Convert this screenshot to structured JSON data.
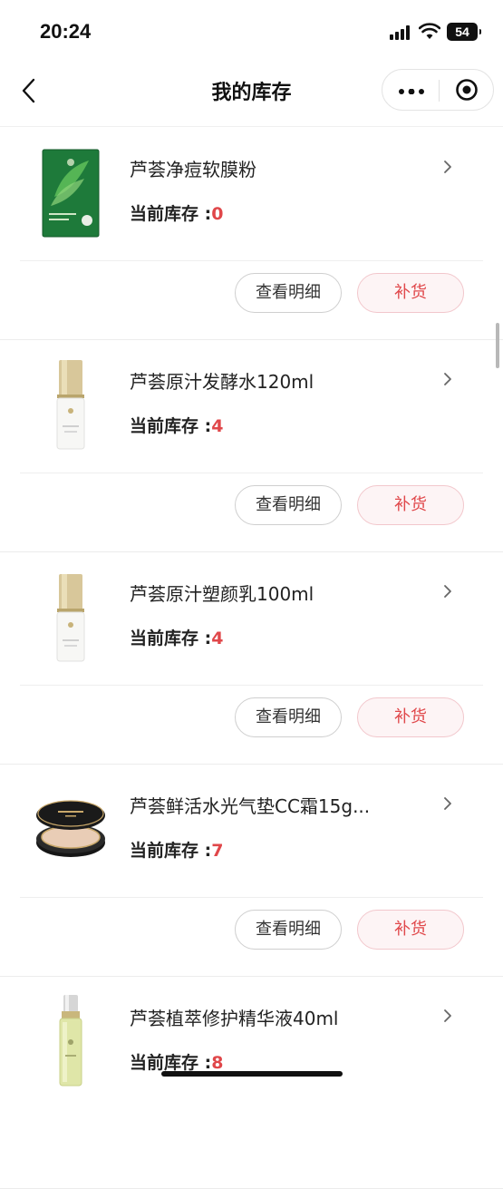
{
  "status_bar": {
    "time": "20:24",
    "battery": "54"
  },
  "nav": {
    "title": "我的库存"
  },
  "stock_label": "当前库存 :",
  "buttons": {
    "detail": "查看明细",
    "restock": "补货"
  },
  "colors": {
    "accent": "#e0474a",
    "restock_bg": "#fdf4f5"
  },
  "items": [
    {
      "name": "芦荟净痘软膜粉",
      "stock": "0",
      "thumb": "green-mask-pack"
    },
    {
      "name": "芦荟原汁发酵水120ml",
      "stock": "4",
      "thumb": "white-bottle"
    },
    {
      "name": "芦荟原汁塑颜乳100ml",
      "stock": "4",
      "thumb": "white-bottle"
    },
    {
      "name": "芦荟鲜活水光气垫CC霜15g...",
      "stock": "7",
      "thumb": "black-cushion-compact"
    },
    {
      "name": "芦荟植萃修护精华液40ml",
      "stock": "8",
      "thumb": "green-serum-bottle"
    }
  ]
}
